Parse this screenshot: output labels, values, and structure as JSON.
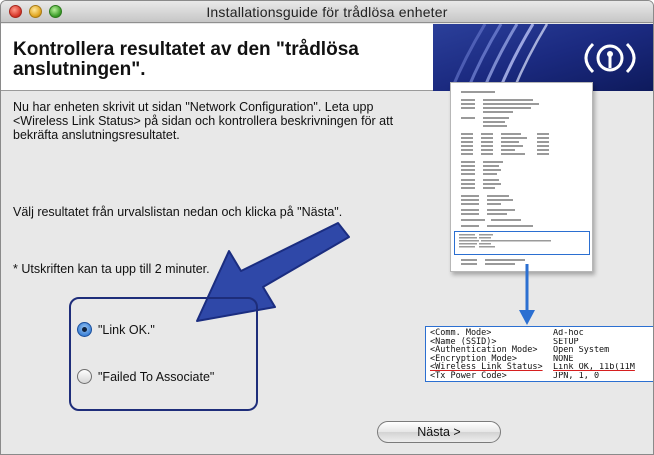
{
  "window": {
    "title": "Installationsguide för trådlösa enheter"
  },
  "header": {
    "heading": "Kontrollera resultatet av den \"trådlösa anslutningen\"."
  },
  "body": {
    "intro": "Nu har enheten skrivit ut sidan \"Network Configuration\". Leta upp <Wireless Link Status> på sidan och kontrollera beskrivningen för att bekräfta anslutningsresultatet.",
    "select_instruction": "Välj resultatet från urvalslistan nedan och klicka på \"Nästa\".",
    "note": "* Utskriften kan ta upp till 2 minuter."
  },
  "options": [
    {
      "label": "\"Link OK.\"",
      "selected": true
    },
    {
      "label": "\"Failed To Associate\"",
      "selected": false
    }
  ],
  "status_panel": {
    "rows": [
      {
        "key": "<Comm. Mode>",
        "value": "Ad-hoc"
      },
      {
        "key": "<Name (SSID)>",
        "value": "SETUP"
      },
      {
        "key": "<Authentication Mode>",
        "value": "Open System"
      },
      {
        "key": "<Encryption Mode>",
        "value": "NONE"
      },
      {
        "key": "<Wireless Link Status>",
        "value": "Link OK, 11b(11M"
      },
      {
        "key": "<Tx Power Code>",
        "value": "JPN, 1, 0"
      }
    ]
  },
  "buttons": {
    "next_label": "Nästa >"
  },
  "colors": {
    "accent_blue": "#1e2d7a",
    "highlight_blue": "#2b6fd1",
    "underline_red": "#d61f1f"
  },
  "icons": {
    "banner": "wireless-wave-logo-icon",
    "pointer": "big-blue-arrow-icon",
    "document": "network-configuration-page-icon"
  }
}
